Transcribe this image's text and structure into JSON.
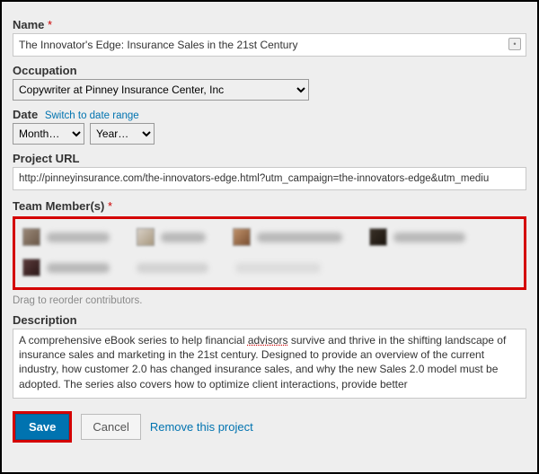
{
  "name": {
    "label": "Name",
    "value": "The Innovator's Edge: Insurance Sales in the 21st Century"
  },
  "occupation": {
    "label": "Occupation",
    "selected": "Copywriter at Pinney Insurance Center, Inc"
  },
  "date": {
    "label": "Date",
    "switch_link": "Switch to date range",
    "month_placeholder": "Month…",
    "year_placeholder": "Year…"
  },
  "project_url": {
    "label": "Project URL",
    "value": "http://pinneyinsurance.com/the-innovators-edge.html?utm_campaign=the-innovators-edge&utm_mediu"
  },
  "team": {
    "label": "Team Member(s)",
    "drag_hint": "Drag to reorder contributors."
  },
  "description": {
    "label": "Description",
    "value_pre": "A comprehensive eBook series to help financial ",
    "value_mark": "advisors",
    "value_post": " survive and thrive in the shifting landscape of insurance sales and marketing in the 21st century.  Designed to provide an overview of the current industry, how customer 2.0 has changed insurance sales, and why the new Sales 2.0 model must be adopted.  The series also covers how to optimize client interactions, provide better"
  },
  "buttons": {
    "save": "Save",
    "cancel": "Cancel",
    "remove": "Remove this project"
  }
}
